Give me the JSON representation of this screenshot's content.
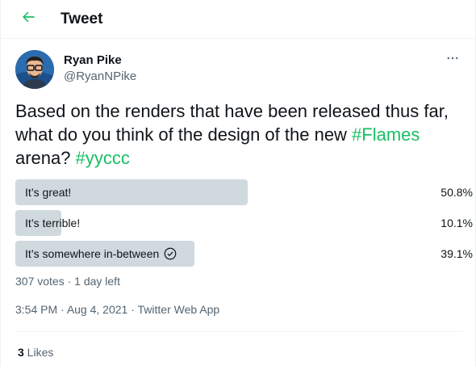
{
  "header": {
    "title": "Tweet",
    "back_icon": "arrow-left-icon",
    "accent": "#17bf63"
  },
  "author": {
    "display_name": "Ryan Pike",
    "handle": "@RyanNPike",
    "more_icon": "more-horizontal-icon"
  },
  "tweet": {
    "text_part1": "Based on the renders that have been released thus far, what do you think of the design of the new ",
    "hashtag1": "#Flames",
    "text_part2": " arena? ",
    "hashtag2": "#yyccc"
  },
  "poll": {
    "options": [
      {
        "label": "It’s great!",
        "percent_text": "50.8%",
        "percent": 50.8,
        "winner": false
      },
      {
        "label": "It’s terrible!",
        "percent_text": "10.1%",
        "percent": 10.1,
        "winner": false
      },
      {
        "label": "It’s somewhere in-between",
        "percent_text": "39.1%",
        "percent": 39.1,
        "winner": true
      }
    ],
    "meta": "307 votes · 1 day left"
  },
  "timestamp": {
    "time": "3:54 PM",
    "sep1": " · ",
    "date": "Aug 4, 2021",
    "sep2": " · ",
    "source": "Twitter Web App"
  },
  "likes": {
    "count": "3",
    "label": " Likes"
  },
  "colors": {
    "bar": "#cfd9de",
    "hashtag": "#17bf63",
    "secondary": "#536471"
  }
}
